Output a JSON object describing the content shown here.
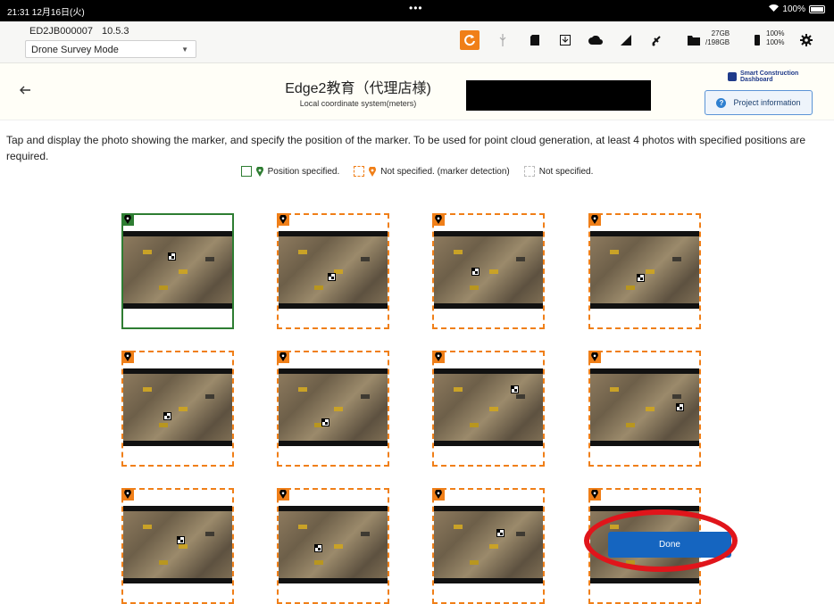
{
  "status_bar": {
    "time": "21:31  12月16日(火)",
    "dots": "•••",
    "battery": "100%"
  },
  "device": {
    "id": "ED2JB000007",
    "version": "10.5.3",
    "mode": "Drone Survey Mode"
  },
  "toolbar": {
    "storage_free": "27GB",
    "storage_total": "/198GB",
    "battery_top": "100%",
    "battery_bottom": "100%"
  },
  "header": {
    "title": "Edge2教育（代理店様)",
    "subtitle": "Local coordinate system(meters)",
    "logo_line1": "Smart Construction",
    "logo_line2": "Dashboard",
    "project_button": "Project information"
  },
  "instructions": "Tap and display the photo showing the marker, and specify the position of the marker. To be used for point cloud generation, at least 4 photos with specified positions are required.",
  "legend": {
    "specified": "Position specified.",
    "marker_detection": "Not specified. (marker detection)",
    "not_specified": "Not specified."
  },
  "photos": [
    {
      "status": "specified"
    },
    {
      "status": "detection"
    },
    {
      "status": "detection"
    },
    {
      "status": "detection"
    },
    {
      "status": "detection"
    },
    {
      "status": "detection"
    },
    {
      "status": "detection"
    },
    {
      "status": "detection"
    },
    {
      "status": "detection"
    },
    {
      "status": "detection"
    },
    {
      "status": "detection"
    },
    {
      "status": "detection"
    }
  ],
  "done_button": "Done",
  "colors": {
    "accent": "#f07f18",
    "specified": "#2e7d32",
    "primary": "#1565c0",
    "highlight": "#e0151b"
  },
  "icons": [
    "back-arrow-icon",
    "pin-icon",
    "gear-icon",
    "cloud-icon",
    "satellite-icon",
    "signal-icon",
    "folder-icon",
    "question-icon"
  ]
}
